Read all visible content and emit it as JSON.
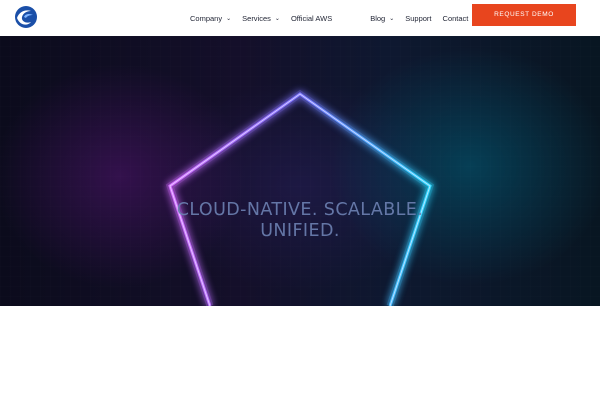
{
  "brand": {
    "logo_icon": "wave-globe-logo-icon",
    "colors": {
      "dark": "#1f2333",
      "accent": "#e8451e",
      "logo_blue": "#1a4fa8"
    }
  },
  "nav": {
    "company": "Company",
    "services": "Services",
    "official_aws": "Official AWS",
    "blog": "Blog",
    "support": "Support",
    "contact": "Contact",
    "dropdown_icon": "chevron-down-icon"
  },
  "cta": {
    "label": "REQUEST DEMO"
  },
  "hero": {
    "headline_line1": "CLOUD-NATIVE. SCALABLE.",
    "headline_line2": "UNIFIED.",
    "shape_icon": "neon-pentagon-icon",
    "colors": {
      "neon_purple": "#d36bff",
      "neon_cyan": "#2ad9ff"
    }
  }
}
